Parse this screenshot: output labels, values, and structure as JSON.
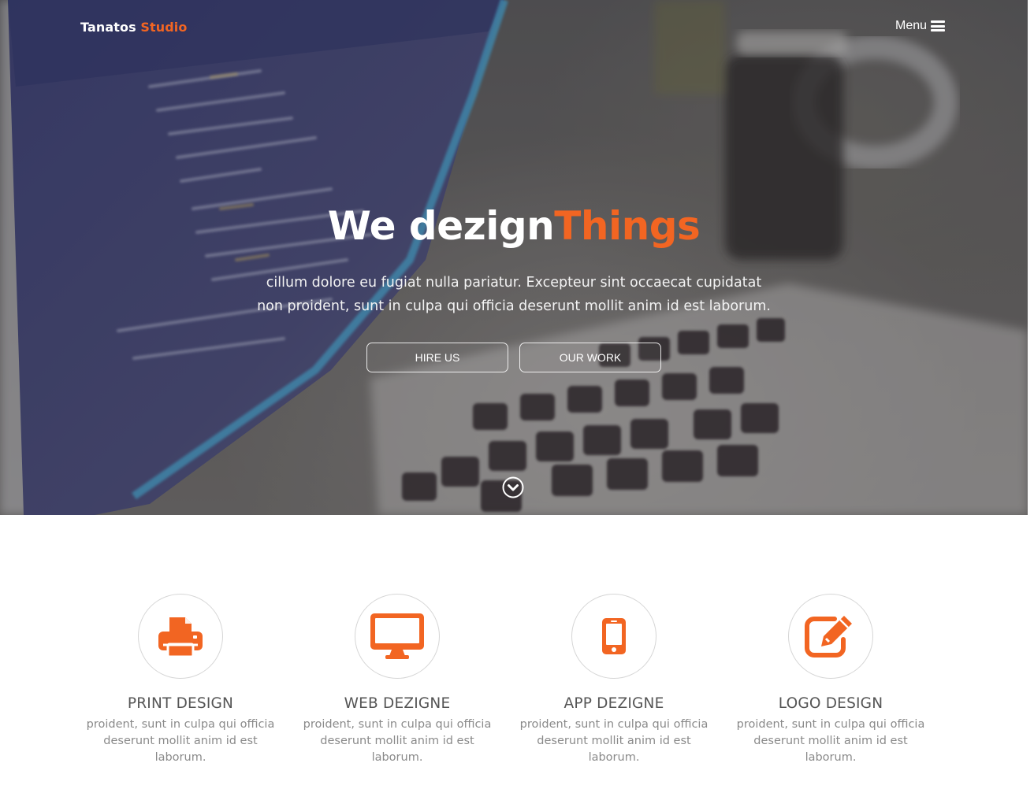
{
  "brand": {
    "name": "Tanatos",
    "accent": "Studio"
  },
  "nav": {
    "menu_label": "Menu",
    "menu_icon": "hamburger-icon"
  },
  "hero": {
    "title": "We dezign",
    "title_accent": "Things",
    "subtitle": "cillum dolore eu fugiat nulla pariatur. Excepteur sint occaecat cupidatat non proident, sunt in culpa qui officia deserunt mollit anim id est laborum.",
    "buttons": [
      {
        "label": "HIRE US"
      },
      {
        "label": "OUR WORK"
      }
    ],
    "scroll_icon": "chevron-down-circle-icon"
  },
  "services": [
    {
      "icon": "printer-icon",
      "title": "PRINT DESIGN",
      "desc": "proident, sunt in culpa qui officia deserunt mollit anim id est laborum."
    },
    {
      "icon": "desktop-icon",
      "title": "WEB DEZIGNE",
      "desc": "proident, sunt in culpa qui officia deserunt mollit anim id est laborum."
    },
    {
      "icon": "mobile-phone-icon",
      "title": "APP DEZIGNE",
      "desc": "proident, sunt in culpa qui officia deserunt mollit anim id est laborum."
    },
    {
      "icon": "edit-pencil-icon",
      "title": "LOGO DESIGN",
      "desc": "proident, sunt in culpa qui officia deserunt mollit anim id est laborum."
    }
  ],
  "colors": {
    "accent": "#f26522",
    "text_dark": "#555555",
    "text_muted": "#8a8a8a"
  }
}
